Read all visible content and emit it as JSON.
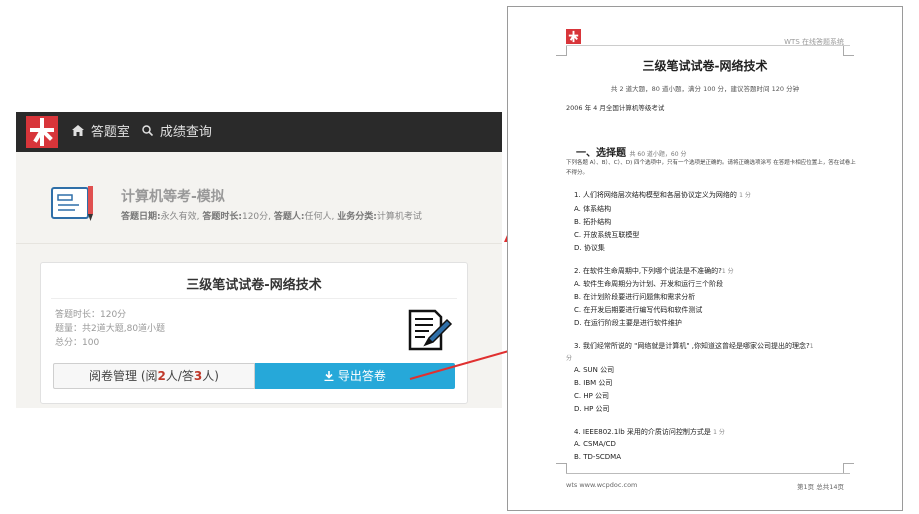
{
  "nav": {
    "home": "答题室",
    "score": "成绩查询"
  },
  "exam": {
    "title": "计算机等考-模拟",
    "date_label": "答题日期:",
    "date_value": "永久有效,",
    "duration_label": "答题时长:",
    "duration_value": "120分,",
    "person_label": "答题人:",
    "person_value": "任何人,",
    "category_label": "业务分类:",
    "category_value": "计算机考试"
  },
  "card": {
    "title": "三级笔试试卷-网络技术",
    "line1": "答题时长：120分",
    "line2": "题量：共2道大题,80道小题",
    "line3": "总分：100",
    "review_prefix": "阅卷管理 (阅",
    "review_read": "2",
    "review_mid": "人/答",
    "review_answer": "3",
    "review_suffix": "人)",
    "export_label": "导出答卷"
  },
  "doc": {
    "brand": "WTS 在线答题系统",
    "title": "三级笔试试卷-网络技术",
    "subtitle": "共 2 道大题，80 道小题，满分 100 分，建议答题时间 120 分钟",
    "year": "2006 年 4 月全国计算机等级考试",
    "section_title": "一、选择题",
    "section_meta": "共 60 道小题，60 分",
    "instructions": "下列各题 A）、B）、C）、D) 四个选项中，只有一个选项是正确的。请将正确选项涂写 在答题卡相应位置上，答在试卷上不得分。",
    "questions": [
      {
        "q": "1. 人们将网络层次结构模型和各层协议定义为网络的",
        "pt": "1 分",
        "opts": [
          "A. 体系结构",
          "B. 拓扑结构",
          "C. 开放系统互联模型",
          "D. 协议集"
        ]
      },
      {
        "q": "2. 在软件生命周期中,下列哪个说法是不准确的?",
        "pt": "1 分",
        "opts": [
          "A. 软件生命周期分为计划、开发和运行三个阶段",
          "B. 在计划阶段要进行问题焦和需求分析",
          "C. 在开发后期要进行编写代码和软件测试",
          "D. 在运行阶段主要是进行软件维护"
        ]
      },
      {
        "q": "3. 我们经常所说的 \"网络就是计算机\" ,你知道这曾经是哪家公司提出的理念?",
        "pt": "1",
        "cont": "分",
        "opts": [
          "A. SUN 公司",
          "B. IBM 公司",
          "C. HP 公司",
          "D. HP 公司"
        ]
      },
      {
        "q": "4. IEEE802.1lb 采用的介质访问控制方式是",
        "pt": "1 分",
        "opts": [
          "A. CSMA/CD",
          "B. TD-SCDMA"
        ]
      }
    ],
    "footer_left": "wts  www.wcpdoc.com",
    "footer_right": "第1页 总共14页"
  },
  "colors": {
    "brand_red": "#d8353a",
    "nav_bg": "#2a2a2a",
    "export_blue": "#26a8d9",
    "arrow_red": "#e03030"
  }
}
